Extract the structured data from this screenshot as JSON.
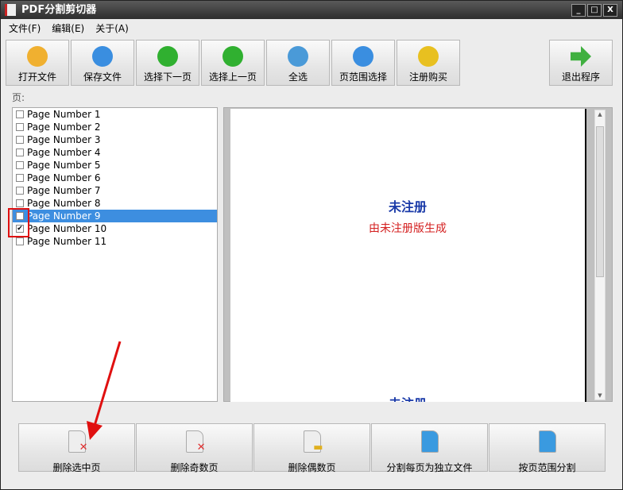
{
  "window": {
    "title": "PDF分割剪切器",
    "controls": [
      "_",
      "□",
      "X"
    ]
  },
  "menu": [
    "文件(F)",
    "编辑(E)",
    "关于(A)"
  ],
  "toolbar": [
    {
      "label": "打开文件",
      "icon": "folder-icon",
      "color": "#f0b030"
    },
    {
      "label": "保存文件",
      "icon": "save-icon",
      "color": "#3a8ee0"
    },
    {
      "label": "选择下一页",
      "icon": "down-arrow-icon",
      "color": "#30b030"
    },
    {
      "label": "选择上一页",
      "icon": "up-arrow-icon",
      "color": "#30b030"
    },
    {
      "label": "全选",
      "icon": "pages-icon",
      "color": "#4a9ad8"
    },
    {
      "label": "页范围选择",
      "icon": "table-icon",
      "color": "#3a8ee0"
    },
    {
      "label": "注册购买",
      "icon": "coin-icon",
      "color": "#e8c020"
    }
  ],
  "exit": {
    "label": "退出程序",
    "icon": "exit-arrow-icon",
    "color": "#40b040"
  },
  "pages_label": "页:",
  "pages": [
    {
      "label": "Page Number 1",
      "checked": false
    },
    {
      "label": "Page Number 2",
      "checked": false
    },
    {
      "label": "Page Number 3",
      "checked": false
    },
    {
      "label": "Page Number 4",
      "checked": false
    },
    {
      "label": "Page Number 5",
      "checked": false
    },
    {
      "label": "Page Number 6",
      "checked": false
    },
    {
      "label": "Page Number 7",
      "checked": false
    },
    {
      "label": "Page Number 8",
      "checked": false
    },
    {
      "label": "Page Number 9",
      "checked": true,
      "selected": true
    },
    {
      "label": "Page Number 10",
      "checked": true
    },
    {
      "label": "Page Number 11",
      "checked": false
    }
  ],
  "preview": {
    "watermark_title": "未注册",
    "watermark_sub": "由未注册版生成"
  },
  "bottom": [
    {
      "label": "删除选中页",
      "icon": "delete-page-icon",
      "mark": "✕",
      "mc": "#e03030"
    },
    {
      "label": "删除奇数页",
      "icon": "delete-odd-icon",
      "mark": "✕",
      "mc": "#e03030"
    },
    {
      "label": "删除偶数页",
      "icon": "delete-even-icon",
      "mark": "▬",
      "mc": "#e0b020"
    },
    {
      "label": "分割每页为独立文件",
      "icon": "split-page-icon",
      "mark": "",
      "mc": "#3a9ae0"
    },
    {
      "label": "按页范围分割",
      "icon": "split-range-icon",
      "mark": "",
      "mc": "#3a9ae0"
    }
  ]
}
